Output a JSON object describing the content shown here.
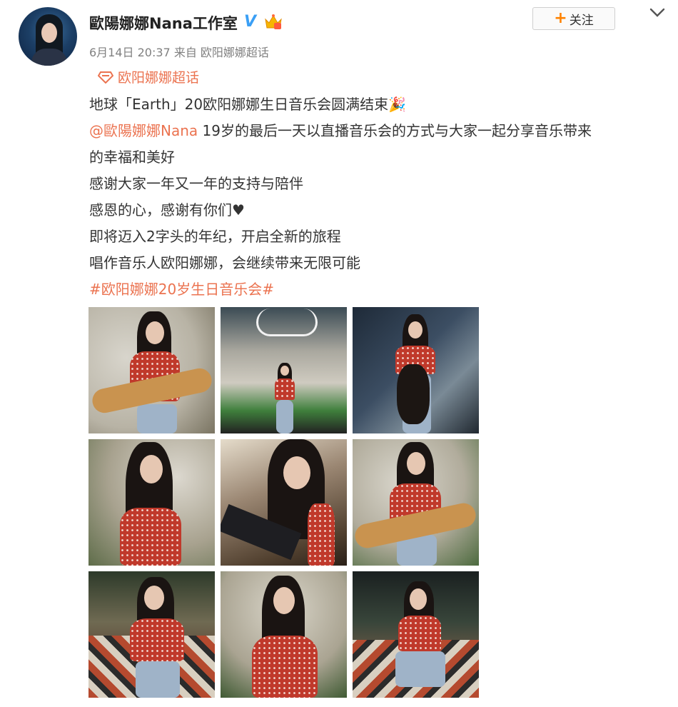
{
  "user": {
    "name": "歐陽娜娜Nana工作室",
    "verified_mark": "V",
    "avatar_icon": "avatar-image",
    "badge_icon": "vip-crown-icon"
  },
  "meta": {
    "date": "6月14日 20:37",
    "source": "来自 欧阳娜娜超话"
  },
  "follow_button": {
    "icon": "plus-icon",
    "label": "关注"
  },
  "menu_icon": "chevron-down-icon",
  "topic": {
    "icon": "diamond-topic-icon",
    "label": "欧阳娜娜超话"
  },
  "post": {
    "line1": "地球「Earth」20欧阳娜娜生日音乐会圆满结束🎉",
    "mention": "@歐陽娜娜Nana",
    "line2_rest": " 19岁的最后一天以直播音乐会的方式与大家一起分享音乐带来",
    "line3": "的幸福和美好",
    "line4": "感谢大家一年又一年的支持与陪伴",
    "line5": "感恩的心，感谢有你们♥",
    "line6": "即将迈入2字头的年纪，开启全新的旅程",
    "line7": "唱作音乐人欧阳娜娜，会继续带来无限可能",
    "hashtag": "#欧阳娜娜20岁生日音乐会#"
  },
  "photos": [
    {
      "desc": "photo-guitar-mic"
    },
    {
      "desc": "photo-stage-wide"
    },
    {
      "desc": "photo-cello-band"
    },
    {
      "desc": "photo-singing-closeup"
    },
    {
      "desc": "photo-piano-closeup"
    },
    {
      "desc": "photo-guitar-mic-2"
    },
    {
      "desc": "photo-sofa-mic"
    },
    {
      "desc": "photo-singing-mic"
    },
    {
      "desc": "photo-sofa-phone"
    }
  ],
  "colors": {
    "accent": "#eb7350",
    "verified": "#3a9ff5",
    "follow_plus": "#ff8200",
    "meta_text": "#808080"
  }
}
